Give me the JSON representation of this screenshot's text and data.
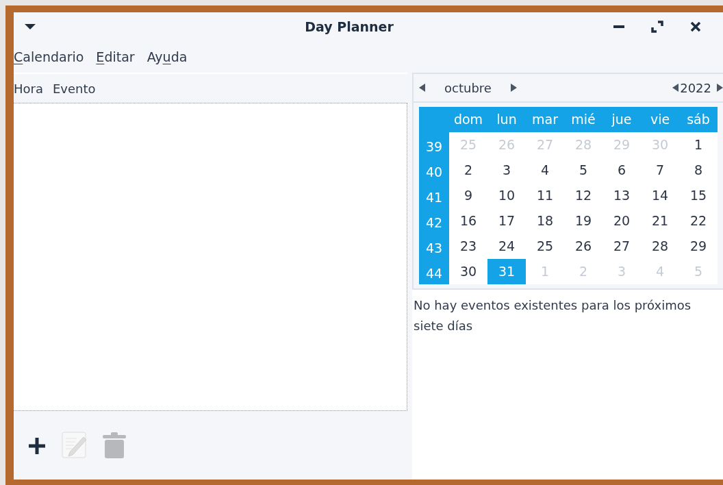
{
  "window": {
    "title": "Day Planner"
  },
  "menu": [
    {
      "key": "C",
      "after": "alendario"
    },
    {
      "key": "E",
      "after": "ditar"
    },
    {
      "before": "Ay",
      "key": "u",
      "after": "da"
    }
  ],
  "event_list": {
    "columns": [
      "Hora",
      "Evento"
    ]
  },
  "toolbar": [
    {
      "kind": "add",
      "disabled": false
    },
    {
      "kind": "edit",
      "disabled": true
    },
    {
      "kind": "delete",
      "disabled": true
    }
  ],
  "calendar": {
    "month": "octubre",
    "year": "2022",
    "weekdays": [
      "dom",
      "lun",
      "mar",
      "mié",
      "jue",
      "vie",
      "sáb"
    ],
    "weeks": [
      {
        "number": "39",
        "days": [
          {
            "label": "25",
            "other_month": true,
            "selected": false
          },
          {
            "label": "26",
            "other_month": true,
            "selected": false
          },
          {
            "label": "27",
            "other_month": true,
            "selected": false
          },
          {
            "label": "28",
            "other_month": true,
            "selected": false
          },
          {
            "label": "29",
            "other_month": true,
            "selected": false
          },
          {
            "label": "30",
            "other_month": true,
            "selected": false
          },
          {
            "label": "1",
            "other_month": false,
            "selected": false
          }
        ]
      },
      {
        "number": "40",
        "days": [
          {
            "label": "2",
            "other_month": false,
            "selected": false
          },
          {
            "label": "3",
            "other_month": false,
            "selected": false
          },
          {
            "label": "4",
            "other_month": false,
            "selected": false
          },
          {
            "label": "5",
            "other_month": false,
            "selected": false
          },
          {
            "label": "6",
            "other_month": false,
            "selected": false
          },
          {
            "label": "7",
            "other_month": false,
            "selected": false
          },
          {
            "label": "8",
            "other_month": false,
            "selected": false
          }
        ]
      },
      {
        "number": "41",
        "days": [
          {
            "label": "9",
            "other_month": false,
            "selected": false
          },
          {
            "label": "10",
            "other_month": false,
            "selected": false
          },
          {
            "label": "11",
            "other_month": false,
            "selected": false
          },
          {
            "label": "12",
            "other_month": false,
            "selected": false
          },
          {
            "label": "13",
            "other_month": false,
            "selected": false
          },
          {
            "label": "14",
            "other_month": false,
            "selected": false
          },
          {
            "label": "15",
            "other_month": false,
            "selected": false
          }
        ]
      },
      {
        "number": "42",
        "days": [
          {
            "label": "16",
            "other_month": false,
            "selected": false
          },
          {
            "label": "17",
            "other_month": false,
            "selected": false
          },
          {
            "label": "18",
            "other_month": false,
            "selected": false
          },
          {
            "label": "19",
            "other_month": false,
            "selected": false
          },
          {
            "label": "20",
            "other_month": false,
            "selected": false
          },
          {
            "label": "21",
            "other_month": false,
            "selected": false
          },
          {
            "label": "22",
            "other_month": false,
            "selected": false
          }
        ]
      },
      {
        "number": "43",
        "days": [
          {
            "label": "23",
            "other_month": false,
            "selected": false
          },
          {
            "label": "24",
            "other_month": false,
            "selected": false
          },
          {
            "label": "25",
            "other_month": false,
            "selected": false
          },
          {
            "label": "26",
            "other_month": false,
            "selected": false
          },
          {
            "label": "27",
            "other_month": false,
            "selected": false
          },
          {
            "label": "28",
            "other_month": false,
            "selected": false
          },
          {
            "label": "29",
            "other_month": false,
            "selected": false
          }
        ]
      },
      {
        "number": "44",
        "days": [
          {
            "label": "30",
            "other_month": false,
            "selected": false
          },
          {
            "label": "31",
            "other_month": false,
            "selected": true
          },
          {
            "label": "1",
            "other_month": true,
            "selected": false
          },
          {
            "label": "2",
            "other_month": true,
            "selected": false
          },
          {
            "label": "3",
            "other_month": true,
            "selected": false
          },
          {
            "label": "4",
            "other_month": true,
            "selected": false
          },
          {
            "label": "5",
            "other_month": true,
            "selected": false
          }
        ]
      }
    ]
  },
  "upcoming": "No hay eventos existentes para los próximos siete días"
}
